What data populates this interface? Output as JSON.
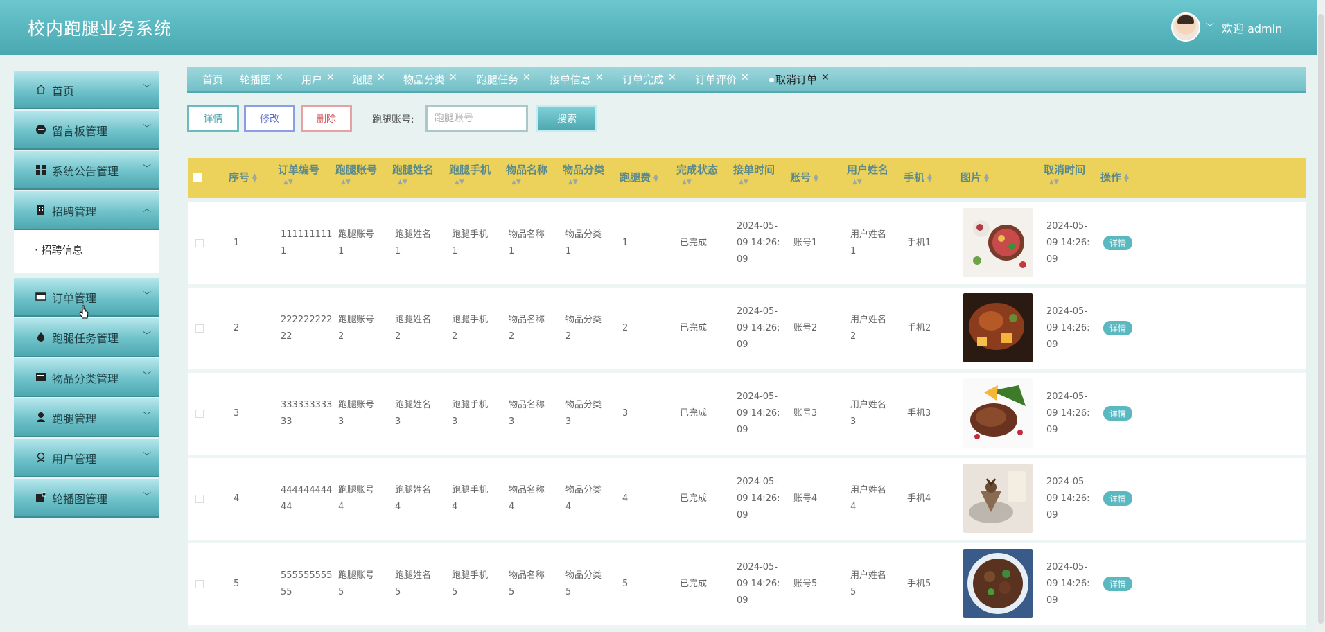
{
  "header": {
    "app_title": "校内跑腿业务系统",
    "welcome_text": "欢迎 admin"
  },
  "sidebar": {
    "items": [
      {
        "label": "首页",
        "icon": "home-icon",
        "chevron": "﹀"
      },
      {
        "label": "留言板管理",
        "icon": "message-icon",
        "chevron": "﹀"
      },
      {
        "label": "系统公告管理",
        "icon": "grid-icon",
        "chevron": "﹀"
      },
      {
        "label": "招聘管理",
        "icon": "building-icon",
        "chevron": "︿"
      },
      {
        "label": "订单管理",
        "icon": "card-icon",
        "chevron": "﹀"
      },
      {
        "label": "跑腿任务管理",
        "icon": "drop-icon",
        "chevron": "﹀"
      },
      {
        "label": "物品分类管理",
        "icon": "box-icon",
        "chevron": "﹀"
      },
      {
        "label": "跑腿管理",
        "icon": "person-icon",
        "chevron": "﹀"
      },
      {
        "label": "用户管理",
        "icon": "user-icon",
        "chevron": "﹀"
      },
      {
        "label": "轮播图管理",
        "icon": "image-icon",
        "chevron": "﹀"
      }
    ],
    "submenu": {
      "label": "招聘信息"
    }
  },
  "tabs": [
    {
      "label": "首页",
      "closable": false
    },
    {
      "label": "轮播图",
      "closable": true
    },
    {
      "label": "用户",
      "closable": true
    },
    {
      "label": "跑腿",
      "closable": true
    },
    {
      "label": "物品分类",
      "closable": true
    },
    {
      "label": "跑腿任务",
      "closable": true
    },
    {
      "label": "接单信息",
      "closable": true
    },
    {
      "label": "订单完成",
      "closable": true
    },
    {
      "label": "订单评价",
      "closable": true
    },
    {
      "label": "取消订单",
      "closable": true,
      "active": true
    }
  ],
  "toolbar": {
    "detail_label": "详情",
    "edit_label": "修改",
    "delete_label": "删除",
    "search_label": "跑腿账号:",
    "search_placeholder": "跑腿账号",
    "search_button": "搜索"
  },
  "table": {
    "headers": [
      "序号",
      "订单编号",
      "跑腿账号",
      "跑腿姓名",
      "跑腿手机",
      "物品名称",
      "物品分类",
      "跑腿费",
      "完成状态",
      "接单时间",
      "账号",
      "用户姓名",
      "手机",
      "图片",
      "取消时间",
      "操作"
    ],
    "action_label": "详情",
    "rows": [
      {
        "index": "1",
        "order_line1": "111111111",
        "order_line2": "1",
        "runner_acct": [
          "跑腿账号",
          "1"
        ],
        "runner_name": [
          "跑腿姓名",
          "1"
        ],
        "runner_phone": [
          "跑腿手机",
          "1"
        ],
        "item_name": [
          "物品名称",
          "1"
        ],
        "item_cat": [
          "物品分类",
          "1"
        ],
        "fee": "1",
        "status": "已完成",
        "accept_time": [
          "2024-05-",
          "09 14:26:",
          "09"
        ],
        "account": "账号1",
        "user_name": [
          "用户姓名",
          "1"
        ],
        "phone": "手机1",
        "image": "salad",
        "cancel_time": [
          "2024-05-",
          "09 14:26:",
          "09"
        ]
      },
      {
        "index": "2",
        "order_line1": "222222222",
        "order_line2": "22",
        "runner_acct": [
          "跑腿账号",
          "2"
        ],
        "runner_name": [
          "跑腿姓名",
          "2"
        ],
        "runner_phone": [
          "跑腿手机",
          "2"
        ],
        "item_name": [
          "物品名称",
          "2"
        ],
        "item_cat": [
          "物品分类",
          "2"
        ],
        "fee": "2",
        "status": "已完成",
        "accept_time": [
          "2024-05-",
          "09 14:26:",
          "09"
        ],
        "account": "账号2",
        "user_name": [
          "用户姓名",
          "2"
        ],
        "phone": "手机2",
        "image": "roast",
        "cancel_time": [
          "2024-05-",
          "09 14:26:",
          "09"
        ]
      },
      {
        "index": "3",
        "order_line1": "333333333",
        "order_line2": "33",
        "runner_acct": [
          "跑腿账号",
          "3"
        ],
        "runner_name": [
          "跑腿姓名",
          "3"
        ],
        "runner_phone": [
          "跑腿手机",
          "3"
        ],
        "item_name": [
          "物品名称",
          "3"
        ],
        "item_cat": [
          "物品分类",
          "3"
        ],
        "fee": "3",
        "status": "已完成",
        "accept_time": [
          "2024-05-",
          "09 14:26:",
          "09"
        ],
        "account": "账号3",
        "user_name": [
          "用户姓名",
          "3"
        ],
        "phone": "手机3",
        "image": "steak",
        "cancel_time": [
          "2024-05-",
          "09 14:26:",
          "09"
        ]
      },
      {
        "index": "4",
        "order_line1": "444444444",
        "order_line2": "44",
        "runner_acct": [
          "跑腿账号",
          "4"
        ],
        "runner_name": [
          "跑腿姓名",
          "4"
        ],
        "runner_phone": [
          "跑腿手机",
          "4"
        ],
        "item_name": [
          "物品名称",
          "4"
        ],
        "item_cat": [
          "物品分类",
          "4"
        ],
        "fee": "4",
        "status": "已完成",
        "accept_time": [
          "2024-05-",
          "09 14:26:",
          "09"
        ],
        "account": "账号4",
        "user_name": [
          "用户姓名",
          "4"
        ],
        "phone": "手机4",
        "image": "dessert",
        "cancel_time": [
          "2024-05-",
          "09 14:26:",
          "09"
        ]
      },
      {
        "index": "5",
        "order_line1": "555555555",
        "order_line2": "55",
        "runner_acct": [
          "跑腿账号",
          "5"
        ],
        "runner_name": [
          "跑腿姓名",
          "5"
        ],
        "runner_phone": [
          "跑腿手机",
          "5"
        ],
        "item_name": [
          "物品名称",
          "5"
        ],
        "item_cat": [
          "物品分类",
          "5"
        ],
        "fee": "5",
        "status": "已完成",
        "accept_time": [
          "2024-05-",
          "09 14:26:",
          "09"
        ],
        "account": "账号5",
        "user_name": [
          "用户姓名",
          "5"
        ],
        "phone": "手机5",
        "image": "braise",
        "cancel_time": [
          "2024-05-",
          "09 14:26:",
          "09"
        ]
      }
    ]
  },
  "colors": {
    "header": "#4aa8b0",
    "table_header": "#ecd15a",
    "accent": "#5ab8c0"
  }
}
